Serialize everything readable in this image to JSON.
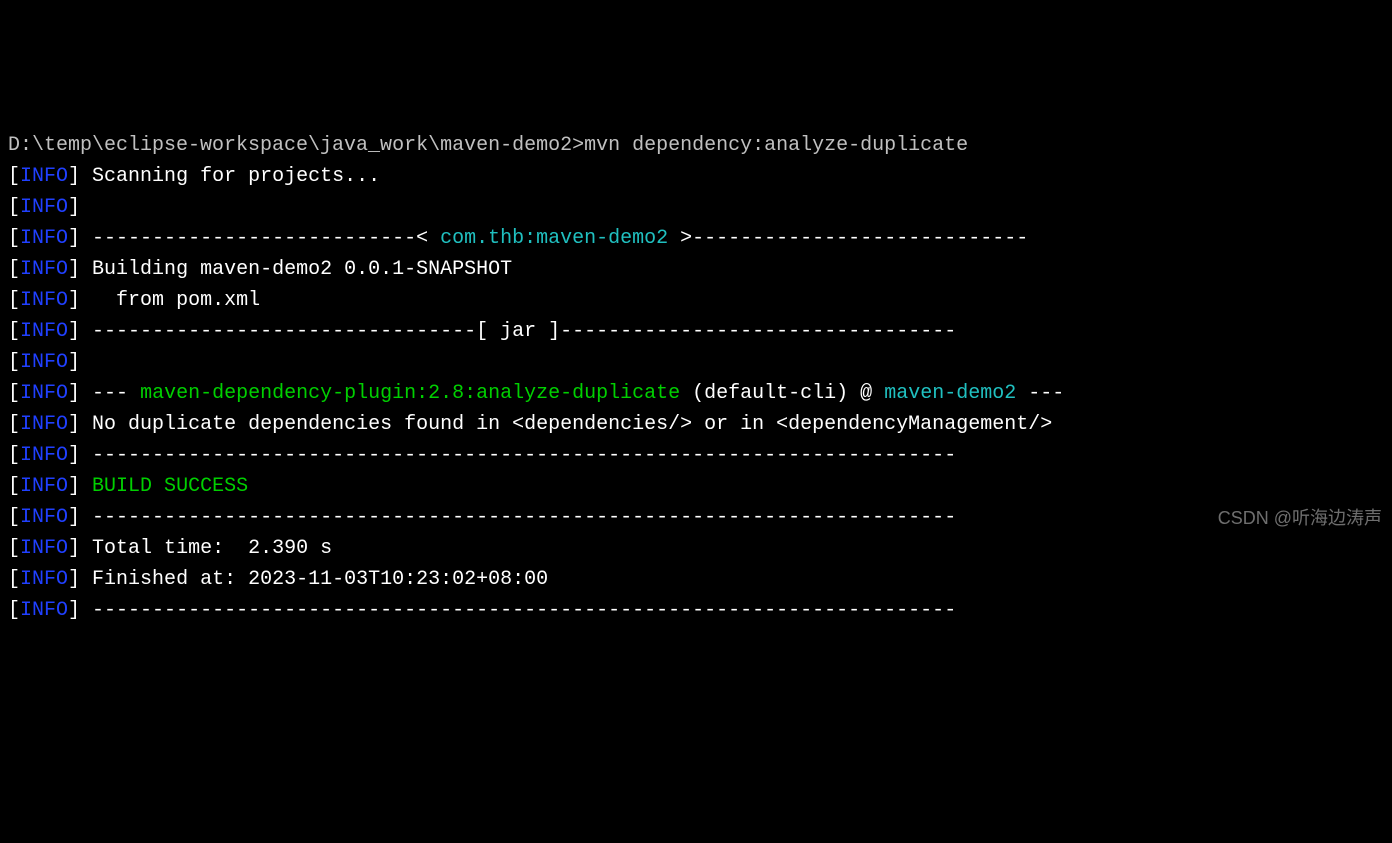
{
  "prompt": {
    "path": "D:\\temp\\eclipse-workspace\\java_work\\maven-demo2>",
    "command": "mvn dependency:analyze-duplicate"
  },
  "tag": "INFO",
  "lbracket": "[",
  "rbracket": "]",
  "lines": {
    "scanning": " Scanning for projects...",
    "sep_project_left": " ---------------------------< ",
    "project_coord": "com.thb:maven-demo2",
    "sep_project_right": " >----------------------------",
    "building": " Building maven-demo2 0.0.1-SNAPSHOT",
    "from_pom": "   from pom.xml",
    "jar_left": " --------------------------------[ ",
    "jar_label": "jar",
    "jar_right": " ]---------------------------------",
    "plugin_prefix": " --- ",
    "plugin_id": "maven-dependency-plugin:2.8:analyze-duplicate",
    "plugin_mid": " (default-cli) @ ",
    "plugin_project": "maven-demo2",
    "plugin_suffix": " ---",
    "nodup": " No duplicate dependencies found in <dependencies/> or in <dependencyManagement/>",
    "dash_full": " ------------------------------------------------------------------------",
    "build_success": " BUILD SUCCESS",
    "total_time": " Total time:  2.390 s",
    "finished_at": " Finished at: 2023-11-03T10:23:02+08:00"
  },
  "watermark": "CSDN @听海边涛声"
}
